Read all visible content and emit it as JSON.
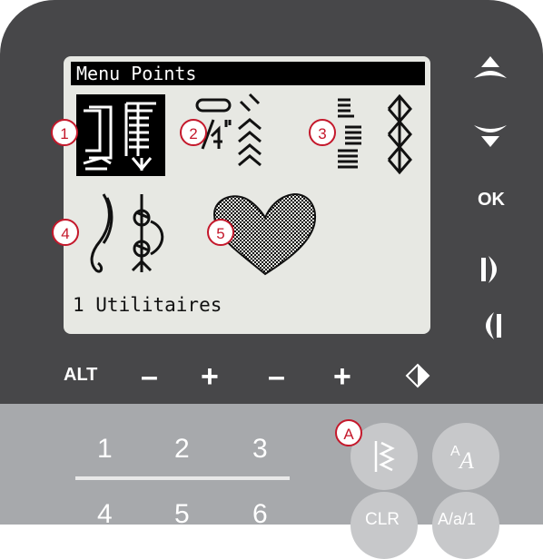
{
  "screen": {
    "title": "Menu Points",
    "footer": "1 Utilitaires",
    "markers": [
      "1",
      "2",
      "3",
      "4",
      "5"
    ]
  },
  "right_buttons": {
    "up": "scroll-up-icon",
    "down": "scroll-down-icon",
    "ok": "OK",
    "right": "step-right-icon",
    "left": "step-left-icon"
  },
  "bottom_row": {
    "alt": "ALT",
    "minus_1": "–",
    "plus_1": "+",
    "minus_2": "–",
    "plus_2": "+",
    "mirror": "mirror-icon"
  },
  "keypad": {
    "row1": [
      "1",
      "2",
      "3"
    ],
    "row2": [
      "4",
      "5",
      "6"
    ]
  },
  "side_buttons": {
    "marker_a": "A",
    "stitch_menu": "stitch-menu-icon",
    "font_menu": "font-menu-icon",
    "clr": "CLR",
    "case": "A/a/1"
  },
  "colors": {
    "panel": "#474749",
    "lower_panel": "#a7a9ac",
    "lcd": "#e7e8e3",
    "marker_red": "#c4182b"
  }
}
